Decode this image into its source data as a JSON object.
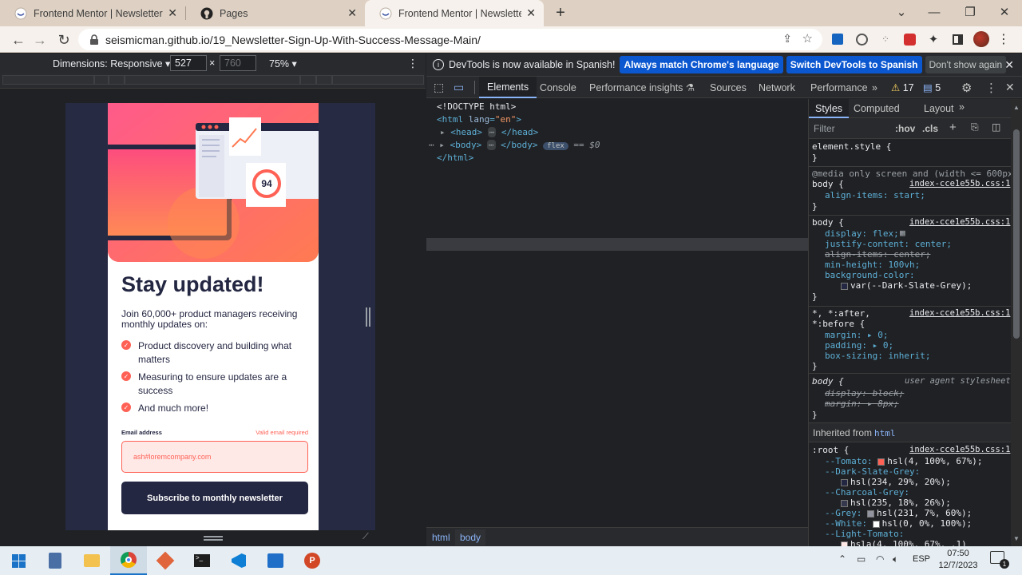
{
  "browser": {
    "tabs": [
      {
        "title": "Frontend Mentor | Newsletter sig",
        "active": false
      },
      {
        "title": "Pages",
        "active": false
      },
      {
        "title": "Frontend Mentor | Newsletter sig",
        "active": true
      }
    ],
    "new_tab": "+",
    "url": "seismicman.github.io/19_Newsletter-Sign-Up-With-Success-Message-Main/"
  },
  "device_toolbar": {
    "dimensions_label": "Dimensions: Responsive",
    "width_value": "527",
    "height_placeholder": "760",
    "times": "×",
    "zoom": "75%"
  },
  "page": {
    "badge_number": "94",
    "title": "Stay updated!",
    "intro": "Join 60,000+ product managers receiving monthly updates on:",
    "list": [
      "Product discovery and building what matters",
      "Measuring to ensure updates are a success",
      "And much more!"
    ],
    "email_label": "Email address",
    "error_msg": "Valid email required",
    "email_value": "ash#loremcompany.com",
    "submit_label": "Subscribe to monthly newsletter"
  },
  "devtools": {
    "info_text": "DevTools is now available in Spanish!",
    "btn_match": "Always match Chrome's language",
    "btn_switch": "Switch DevTools to Spanish",
    "btn_dont": "Don't show again",
    "tabs": [
      "Elements",
      "Console",
      "Performance insights",
      "Sources",
      "Network",
      "Performance"
    ],
    "warnings": "17",
    "messages": "5",
    "dom": {
      "doctype": "<!DOCTYPE html>",
      "html_open": "<html",
      "lang_attr": "lang",
      "lang_val": "\"en\"",
      "head": "<head>",
      "head_close": "</head>",
      "body": "<body>",
      "body_close": "</body>",
      "flex_badge": "flex",
      "selected": "== $0",
      "html_close": "</html>"
    },
    "breadcrumb": [
      "html",
      "body"
    ],
    "styles": {
      "tabs": [
        "Styles",
        "Computed",
        "Layout"
      ],
      "filter_placeholder": "Filter",
      "hov": ":hov",
      "cls": ".cls",
      "element_style": "element.style {",
      "close_brace": "}",
      "media": "@media only screen and (width <= 600px)",
      "body_sel": "body {",
      "source": "index-cce1e55b.css:1",
      "align_start": "align-items: start;",
      "display": "display: flex;",
      "justify": "justify-content: center;",
      "align_center": "align-items: center;",
      "min_height": "min-height: 100vh;",
      "bg_color": "background-color:",
      "bg_var": "var(--Dark-Slate-Grey);",
      "universal": "*, *:after,",
      "before": "*:before {",
      "margin": "margin: ▸ 0;",
      "padding": "padding: ▸ 0;",
      "box_sizing": "box-sizing: inherit;",
      "ua_label": "user agent stylesheet",
      "ua_display": "display: block;",
      "ua_margin": "margin: ▸ 8px;",
      "inherited": "Inherited from",
      "inherited_el": "html",
      "root": ":root {",
      "tomato": "--Tomato:",
      "tomato_val": "hsl(4, 100%, 67%);",
      "dsg": "--Dark-Slate-Grey:",
      "dsg_val": "hsl(234, 29%, 20%);",
      "cg": "--Charcoal-Grey:",
      "cg_val": "hsl(235, 18%, 26%);",
      "grey": "--Grey:",
      "grey_val": "hsl(231, 7%, 60%);",
      "white": "--White:",
      "white_val": "hsl(0, 0%, 100%);",
      "lt": "--Light-Tomato:",
      "lt_val": "hsla(4, 100%, 67%, .1)"
    }
  },
  "taskbar": {
    "lang": "ESP",
    "time": "07:50",
    "date": "12/7/2023",
    "notifications": "1"
  },
  "colors": {
    "tomato": "#ff6155",
    "dark_slate": "#242742",
    "charcoal": "#36384e",
    "tab_strip": "#ded1c3",
    "devtools_blue": "#0b57d0"
  }
}
